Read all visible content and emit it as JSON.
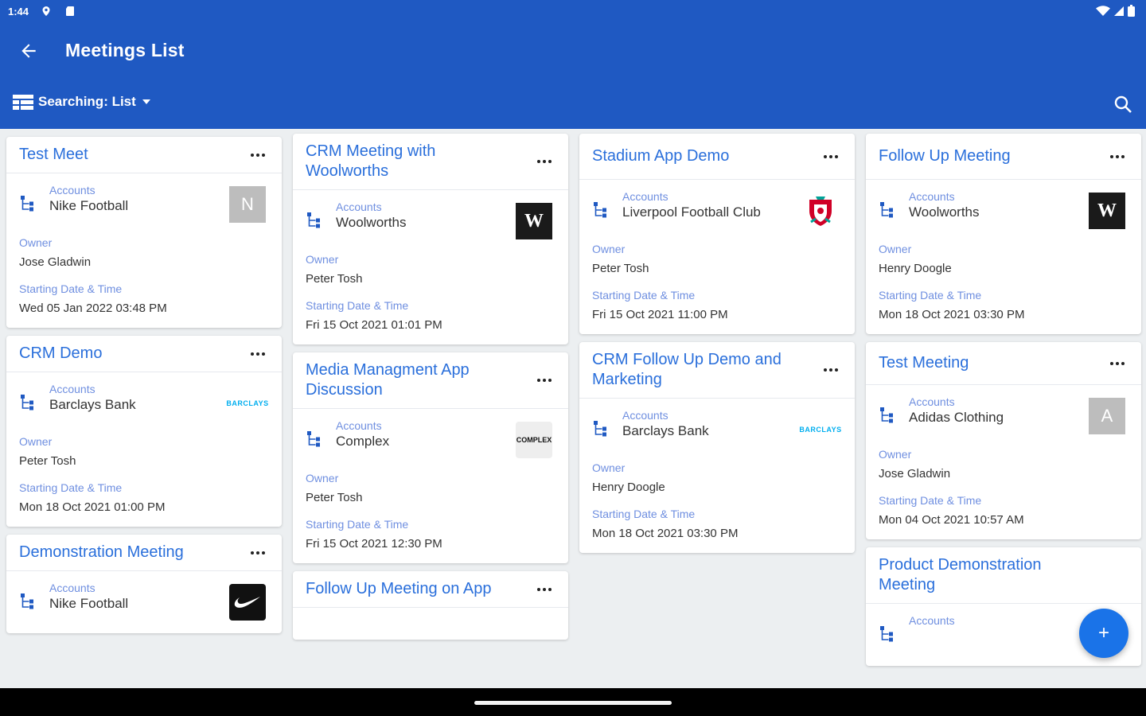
{
  "status": {
    "time": "1:44"
  },
  "header": {
    "title": "Meetings List",
    "search_mode": "Searching: List"
  },
  "labels": {
    "accounts": "Accounts",
    "owner": "Owner",
    "start": "Starting Date & Time"
  },
  "colors": {
    "appbar": "#1f59c2",
    "accent": "#2a6fdb",
    "fab": "#1a73e8"
  },
  "columns": [
    [
      {
        "title": "Test Meet",
        "account": "Nike Football",
        "logo": "N",
        "owner": "Jose Gladwin",
        "start": "Wed 05 Jan 2022 03:48 PM"
      },
      {
        "title": "CRM Demo",
        "account": "Barclays Bank",
        "logo": "BARCLAYS",
        "owner": "Peter Tosh",
        "start": "Mon 18 Oct 2021 01:00 PM"
      },
      {
        "title": "Demonstration Meeting",
        "account": "Nike Football",
        "logo": "nike-swoosh-icon",
        "owner": "",
        "start": ""
      }
    ],
    [
      {
        "title": "CRM Meeting with Woolworths",
        "account": "Woolworths",
        "logo": "W",
        "owner": "Peter Tosh",
        "start": "Fri 15 Oct 2021 01:01 PM"
      },
      {
        "title": "Media Managment App Discussion",
        "account": "Complex",
        "logo": "COMPLEX",
        "owner": "Peter Tosh",
        "start": "Fri 15 Oct 2021 12:30 PM"
      },
      {
        "title": "Follow Up Meeting on App",
        "account": "",
        "logo": "",
        "owner": "",
        "start": ""
      }
    ],
    [
      {
        "title": "Stadium App Demo",
        "account": "Liverpool Football Club",
        "logo": "liverpool-crest-icon",
        "owner": "Peter Tosh",
        "start": "Fri 15 Oct 2021 11:00 PM"
      },
      {
        "title": "CRM Follow Up Demo and Marketing",
        "account": "Barclays Bank",
        "logo": "BARCLAYS",
        "owner": "Henry Doogle",
        "start": "Mon 18 Oct 2021 03:30 PM"
      }
    ],
    [
      {
        "title": "Follow Up Meeting",
        "account": "Woolworths",
        "logo": "W",
        "owner": "Henry Doogle",
        "start": "Mon 18 Oct 2021 03:30 PM"
      },
      {
        "title": "Test Meeting",
        "account": "Adidas Clothing",
        "logo": "A",
        "owner": "Jose Gladwin",
        "start": "Mon 04 Oct 2021 10:57 AM"
      },
      {
        "title": "Product Demonstration Meeting",
        "account": "",
        "logo": "",
        "owner": "",
        "start": ""
      }
    ]
  ],
  "fab": {
    "label": "+"
  }
}
